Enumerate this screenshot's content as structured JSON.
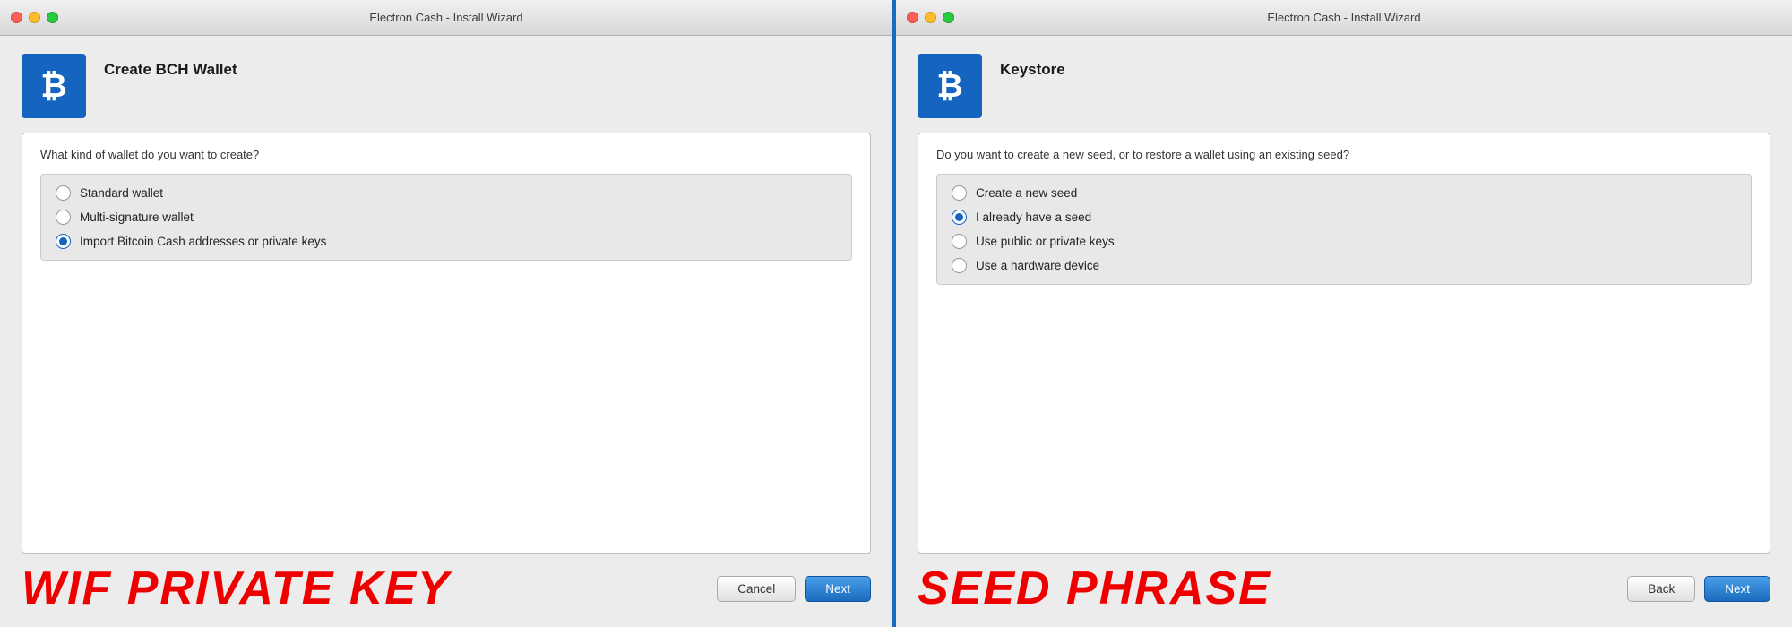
{
  "left_panel": {
    "title_bar": {
      "title": "Electron Cash  -  Install Wizard"
    },
    "logo": {
      "symbol": "₿"
    },
    "dialog_title": "Create BCH Wallet",
    "question": "What kind of wallet do you want to create?",
    "options": [
      {
        "id": "standard",
        "label": "Standard wallet",
        "selected": false
      },
      {
        "id": "multisig",
        "label": "Multi-signature wallet",
        "selected": false
      },
      {
        "id": "import",
        "label": "Import Bitcoin Cash addresses or private keys",
        "selected": true
      }
    ],
    "footer_label": "WIF PRIVATE KEY",
    "buttons": {
      "cancel": "Cancel",
      "next": "Next"
    }
  },
  "right_panel": {
    "title_bar": {
      "title": "Electron Cash  -  Install Wizard"
    },
    "logo": {
      "symbol": "₿"
    },
    "dialog_title": "Keystore",
    "question": "Do you want to create a new seed, or to restore a wallet using an existing seed?",
    "options": [
      {
        "id": "new-seed",
        "label": "Create a new seed",
        "selected": false
      },
      {
        "id": "existing-seed",
        "label": "I already have a seed",
        "selected": true
      },
      {
        "id": "public-private",
        "label": "Use public or private keys",
        "selected": false
      },
      {
        "id": "hardware",
        "label": "Use a hardware device",
        "selected": false
      }
    ],
    "footer_label": "SEED PHRASE",
    "buttons": {
      "back": "Back",
      "next": "Next"
    }
  }
}
